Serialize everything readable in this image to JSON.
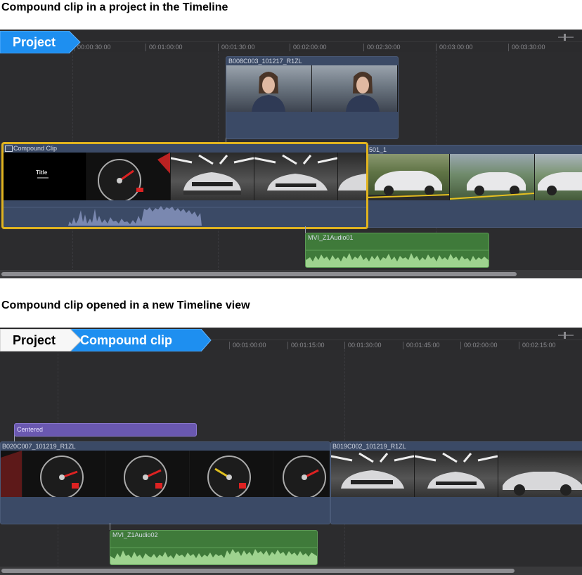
{
  "captions": {
    "top": "Compound clip in a project in the Timeline",
    "bottom": "Compound clip opened in a new Timeline view"
  },
  "timeline1": {
    "breadcrumb": [
      "Project"
    ],
    "ticks": [
      "00:00:30:00",
      "00:01:00:00",
      "00:01:30:00",
      "00:02:00:00",
      "00:02:30:00",
      "00:03:00:00",
      "00:03:30:00"
    ],
    "connected_clip": "B008C003_101217_R1ZL",
    "compound_clip": "Compound Clip",
    "title_frame_text": "Title",
    "next_clip": "501_1",
    "audio_clip": "MVI_Z1Audio01"
  },
  "timeline2": {
    "breadcrumb": [
      "Project",
      "Compound clip"
    ],
    "ticks": [
      "00:01:00:00",
      "00:01:15:00",
      "00:01:30:00",
      "00:01:45:00",
      "00:02:00:00",
      "00:02:15:00"
    ],
    "title_clip": "Centered",
    "clip_a": "B020C007_101219_R1ZL",
    "clip_b": "B019C002_101219_R1ZL",
    "audio_clip": "MVI_Z1Audio02"
  },
  "colors": {
    "highlight": "#e0b31f",
    "breadcrumb_active": "#1e8ff0",
    "video_clip": "#3b4a66",
    "audio_clip": "#3f7a3a",
    "title_clip": "#6a58b0"
  },
  "icons": [
    "zoom-slider-icon",
    "compound-clip-icon"
  ]
}
